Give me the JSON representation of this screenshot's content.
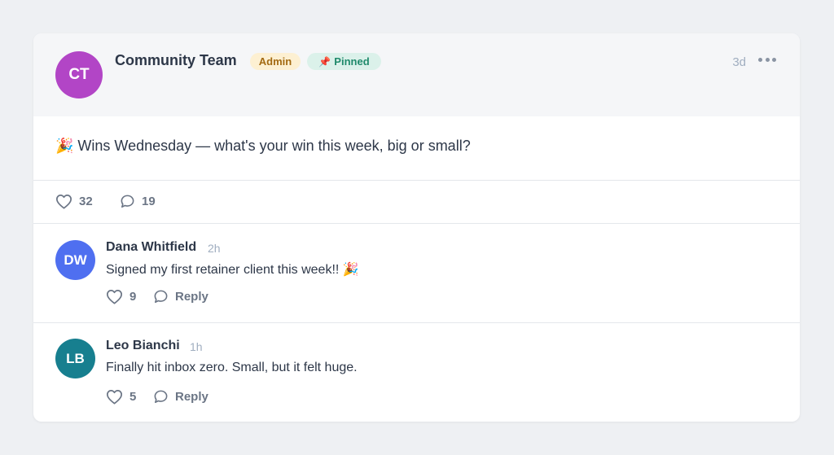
{
  "colors": {
    "ct_avatar": "#b245c6",
    "dw_avatar": "#4f6ff0",
    "lb_avatar": "#177f8f",
    "admin_bg": "#fdf0d2",
    "admin_text": "#a36a12",
    "pinned_bg": "#dbf1ea",
    "pinned_text": "#1f8a6b"
  },
  "post": {
    "avatar_initials": "CT",
    "author": "Community Team",
    "admin_badge": "Admin",
    "pinned_icon": "📌",
    "pinned_badge": "Pinned",
    "time": "3d",
    "more_icon": "more-horizontal-icon",
    "body": "🎉 Wins Wednesday — what's your win this week, big or small?",
    "likes": "32",
    "comments": "19"
  },
  "comments": [
    {
      "initials": "DW",
      "name": "Dana Whitfield",
      "time": "2h",
      "text": "Signed my first retainer client this week!! 🎉",
      "likes": "9",
      "reply_label": "Reply"
    },
    {
      "initials": "LB",
      "name": "Leo Bianchi",
      "time": "1h",
      "text": "Finally hit inbox zero. Small, but it felt huge.",
      "likes": "5",
      "reply_label": "Reply"
    }
  ]
}
